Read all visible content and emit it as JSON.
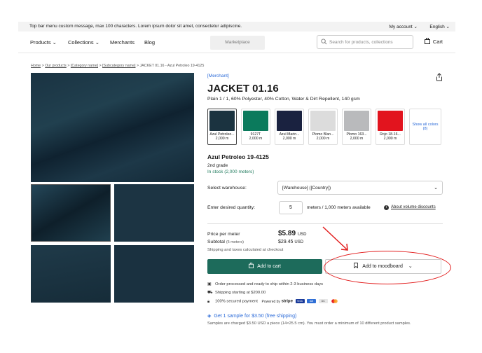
{
  "topbar": {
    "message": "Top bar menu custom message, max 100 characters. Lorem ipsum dolor sit amet, consectetur adipiscine.",
    "account": "My account ⌄",
    "language": "English ⌄"
  },
  "nav": {
    "products": "Products ⌄",
    "collections": "Collections ⌄",
    "merchants": "Merchants",
    "blog": "Blog",
    "marketplace": "Marketplace",
    "search_placeholder": "Search for products, collections",
    "cart": "Cart"
  },
  "breadcrumb": {
    "home": "Home",
    "our_products": "Our products",
    "category": "[Category name]",
    "subcategory": "[Subcategory name]",
    "current": "JACKET 01.16 - Azul Petroleo 19-4125"
  },
  "product": {
    "merchant": "[Merchant]",
    "title": "JACKET 01.16",
    "description": "Plain 1 / 1, 60% Polyester, 40% Cotton, Water & Dirt Repellent, 140 gsm",
    "swatches": [
      {
        "name": "Azul Petroleo...",
        "qty": "2,000 m",
        "color": "#1b3340"
      },
      {
        "name": "9127T",
        "qty": "2,000 m",
        "color": "#0b7a5c"
      },
      {
        "name": "Azul Marin...",
        "qty": "2,000 m",
        "color": "#1a2240"
      },
      {
        "name": "Plomo Blan...",
        "qty": "2,000 m",
        "color": "#dcdcdc"
      },
      {
        "name": "Plomo 163...",
        "qty": "2,000 m",
        "color": "#b9babc"
      },
      {
        "name": "Rojo 18-16...",
        "qty": "2,000 m",
        "color": "#e2141e"
      }
    ],
    "show_all": "Show all colors (8)",
    "variant_name": "Azul Petroleo 19-4125",
    "grade": "2nd grade",
    "stock": "In stock (2,000 meters)"
  },
  "order": {
    "warehouse_label": "Select warehouse:",
    "warehouse_value": "[Warehouse] ([Country])",
    "quantity_label": "Enter desired quantity:",
    "quantity_value": "5",
    "availability": "meters / 1,000 meters available",
    "volume_discounts": "About volume discounts",
    "price_label": "Price per meter",
    "price_value": "$5.89",
    "price_currency": "USD",
    "subtotal_label": "Subtotal",
    "subtotal_qty": "(5 meters)",
    "subtotal_value": "$29.45",
    "subtotal_currency": "USD",
    "shipping_note": "Shipping and taxes calculated at checkout",
    "add_to_cart": "Add to cart",
    "add_to_moodboard": "Add to moodboard",
    "features": [
      "Order processed and ready to ship within 2-3 business days",
      "Shipping starting at $200.00",
      "100% secured payment"
    ],
    "powered_by": "Powered by",
    "stripe": "stripe",
    "sample_offer": "Get 1 sample for $3.50 (free shipping)",
    "sample_note": "Samples are charged $3.50 USD a piece (14×25.5 cm). You must order a minimum of 10 different product samples."
  },
  "colors": {
    "accent_green": "#1d6b5b",
    "link_blue": "#2a6ad8",
    "annotation_red": "#e21b1b"
  }
}
